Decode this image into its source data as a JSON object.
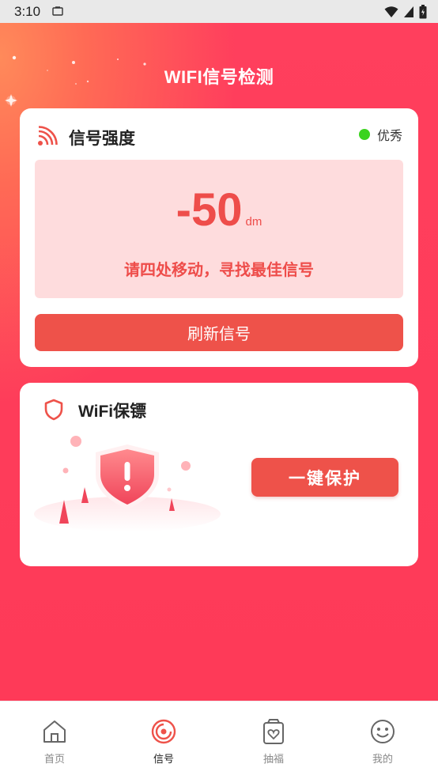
{
  "status_bar": {
    "time": "3:10"
  },
  "header": {
    "title": "WIFI信号检测"
  },
  "signal_card": {
    "title": "信号强度",
    "quality_label": "优秀",
    "quality_color": "#3ad31e",
    "reading_value": "-50",
    "reading_unit": "dm",
    "hint": "请四处移动，寻找最佳信号",
    "refresh_label": "刷新信号"
  },
  "guard_card": {
    "title": "WiFi保镖",
    "protect_label": "一键保护"
  },
  "nav": {
    "items": [
      {
        "label": "首页",
        "icon": "home-icon"
      },
      {
        "label": "信号",
        "icon": "signal-target-icon"
      },
      {
        "label": "抽福",
        "icon": "lucky-bag-icon"
      },
      {
        "label": "我的",
        "icon": "smiley-icon"
      }
    ],
    "active_index": 1
  },
  "colors": {
    "accent": "#ee524a",
    "background": "#fe3a58"
  }
}
